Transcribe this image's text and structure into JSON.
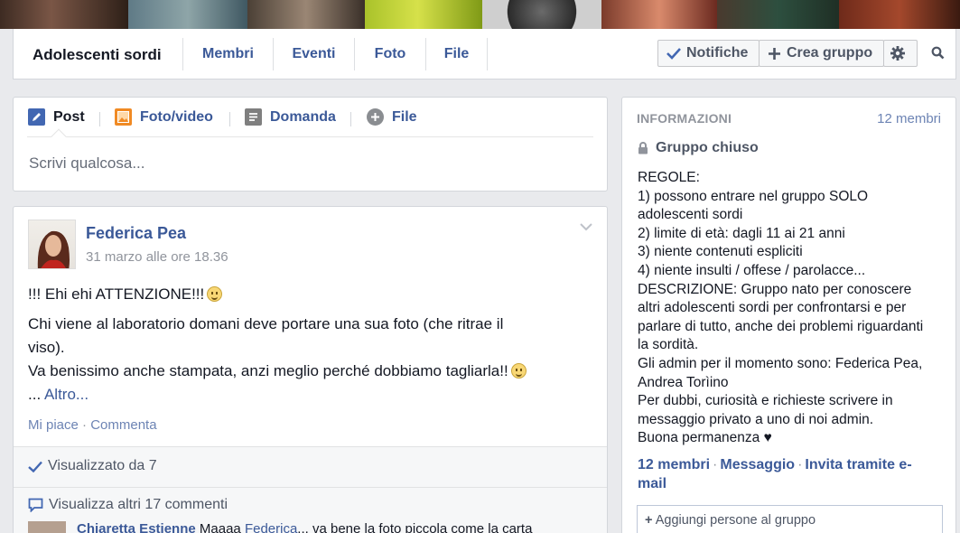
{
  "group": {
    "name": "Adolescenti sordi",
    "tabs": [
      "Membri",
      "Eventi",
      "Foto",
      "File"
    ],
    "notify_label": "Notifiche",
    "create_label": "Crea gruppo"
  },
  "composer": {
    "tabs": [
      "Post",
      "Foto/video",
      "Domanda",
      "File"
    ],
    "placeholder": "Scrivi qualcosa..."
  },
  "post": {
    "author": "Federica Pea",
    "timestamp": "31 marzo alle ore 18.36",
    "line1": "!!! Ehi ehi ATTENZIONE!!!",
    "line2": "Chi viene al laboratorio domani deve portare una sua foto (che ritrae il",
    "line3": "viso).",
    "line4": "Va benissimo anche stampata, anzi meglio perché dobbiamo tagliarla!!",
    "more_prefix": "...",
    "more_link": "Altro...",
    "like": "Mi piace",
    "sep": " · ",
    "comment": "Commenta",
    "seen": "Visualizzato da 7",
    "more_comments": "Visualizza altri 17 commenti",
    "comment_author": "Chiaretta Estienne",
    "comment_text": "Maaaa",
    "comment_mention": "Federica",
    "comment_rest": "... va bene la foto piccola come la carta"
  },
  "info": {
    "title": "INFORMAZIONI",
    "members": "12 membri",
    "privacy": "Gruppo chiuso",
    "description": [
      "REGOLE:",
      "1) possono entrare nel gruppo SOLO",
      "adolescenti sordi",
      "2) limite di età: dagli 11 ai 21 anni",
      "3) niente contenuti espliciti",
      "4) niente insulti / offese / parolacce...",
      "DESCRIZIONE: Gruppo nato per conoscere",
      "altri adolescenti sordi per confrontarsi e per",
      "parlare di tutto, anche dei problemi riguardanti",
      "la sordità.",
      "Gli admin per il momento sono: Federica Pea,",
      "Andrea Torìino",
      "Per dubbi, curiosità e richieste scrivere in",
      "messaggio privato a uno di noi admin.",
      "Buona permanenza ♥"
    ],
    "link_members": "12 membri",
    "link_message": "Messaggio",
    "link_invite": "Invita tramite e-mail",
    "link_sep": "·",
    "add_people": "Aggiungi persone al gruppo"
  },
  "colors": {
    "link": "#3b5998",
    "background": "#e9eaed",
    "muted": "#90949c"
  }
}
